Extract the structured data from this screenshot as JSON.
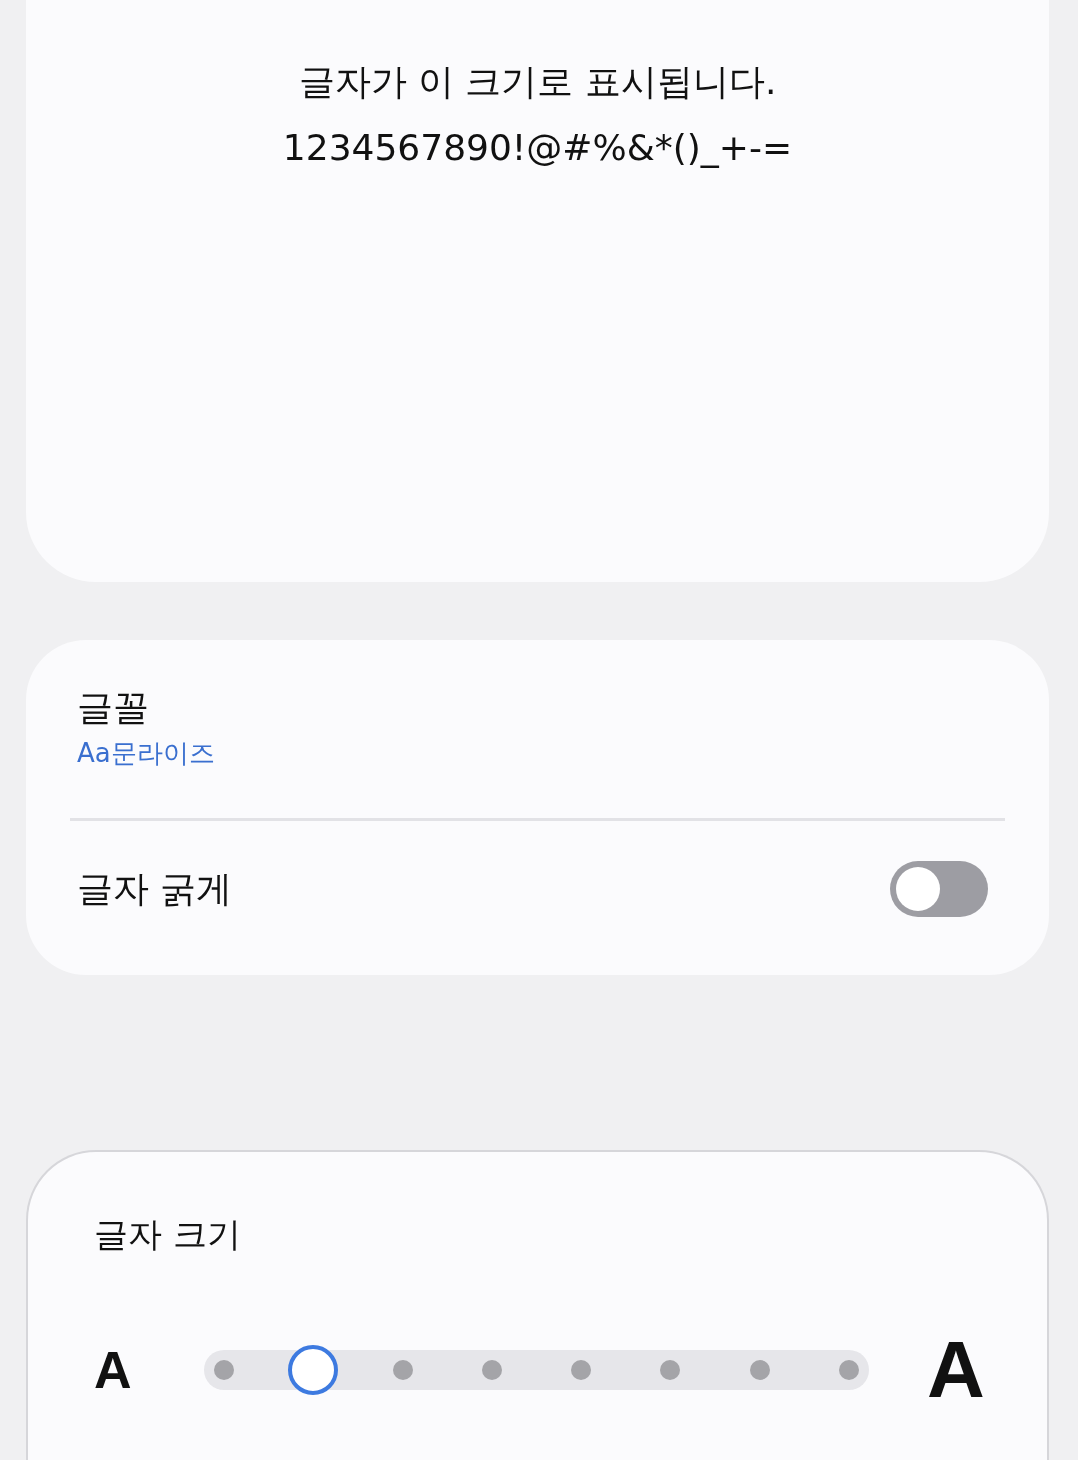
{
  "preview": {
    "lines": [
      "글자가 이 크기로 표시됩니다.",
      "1234567890!@#%&*()_+-="
    ]
  },
  "font": {
    "label": "글꼴",
    "value": "Aa문라이즈"
  },
  "bold": {
    "label": "글자 굵게",
    "on": false
  },
  "size": {
    "label": "글자 크기",
    "small": "A",
    "large": "A",
    "level": 0.143
  }
}
